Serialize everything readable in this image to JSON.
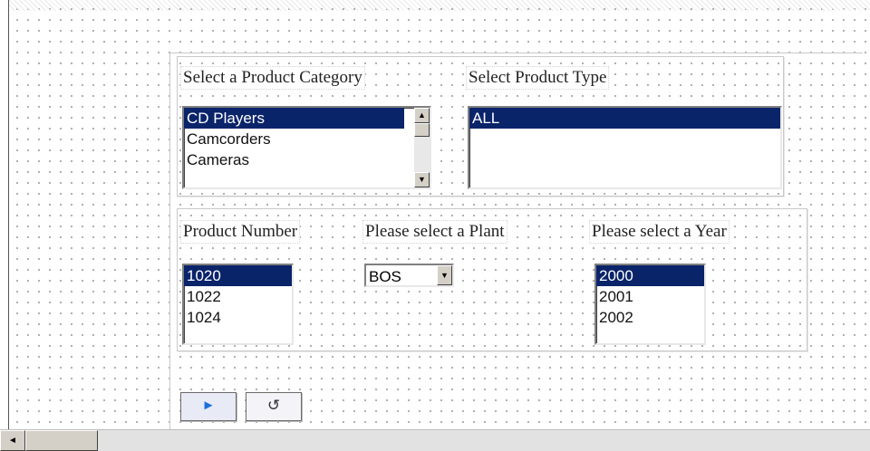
{
  "category": {
    "label": "Select a Product Category",
    "options": [
      "CD Players",
      "Camcorders",
      "Cameras"
    ],
    "selected_index": 0
  },
  "product_type": {
    "label": "Select Product Type",
    "options": [
      "ALL"
    ],
    "selected_index": 0
  },
  "product_number": {
    "label": "Product Number",
    "options": [
      "1020",
      "1022",
      "1024"
    ],
    "selected_index": 0
  },
  "plant": {
    "label": "Please select a Plant",
    "value": "BOS"
  },
  "year": {
    "label": "Please select a Year",
    "options": [
      "2000",
      "2001",
      "2002"
    ],
    "selected_index": 0
  },
  "buttons": {
    "submit_icon": "play-icon",
    "reset_icon": "reset-icon",
    "submit_glyph": "►",
    "reset_glyph": "↺"
  },
  "colors": {
    "selection": "#0a246a",
    "submit_glyph": "#1e6fd9"
  }
}
